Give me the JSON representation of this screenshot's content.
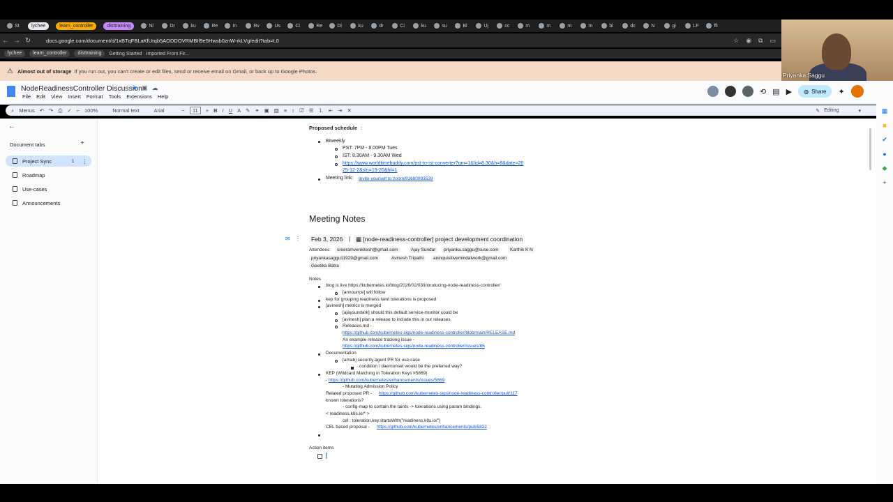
{
  "browser": {
    "tabs": [
      "St",
      "lychee",
      "learn_controller",
      "disttraining",
      "Nl",
      "Dr",
      "ku",
      "Re",
      "In",
      "Rv",
      "Us",
      "Ci",
      "Re",
      "Di",
      "ku",
      "dr",
      "Ci",
      "ku",
      "su",
      "Bl",
      "Uj",
      "cc",
      "m",
      "m",
      "m",
      "m",
      "bl",
      "dc",
      "N",
      "gi",
      "LF",
      "ffi"
    ],
    "url": "docs.google.com/document/d/1xBTqFBLaKfUrqb5AODDOVRMBIf9e5Hwsb0znW-rkLVg/edit?tab=t.0",
    "bookmarks": [
      "lychee",
      "learn_controller",
      "disttraining",
      "Getting Started",
      "Imported From Fir..."
    ]
  },
  "video": {
    "name": "Priyanka Saggu"
  },
  "banner": {
    "title": "Almost out of storage",
    "text": "If you run out, you can't create or edit files, send or receive email on Gmail, or back up to Google Photos."
  },
  "doc": {
    "title": "NodeReadinessController Discussion",
    "menu": [
      "File",
      "Edit",
      "View",
      "Insert",
      "Format",
      "Tools",
      "Extensions",
      "Help"
    ],
    "share_label": "Share"
  },
  "toolbar": {
    "menus": "Menus",
    "zoom": "100%",
    "style": "Normal text",
    "font": "Arial",
    "size": "11",
    "mode": "Editing"
  },
  "sidebar": {
    "label": "Document tabs",
    "items": [
      {
        "label": "Project Sync",
        "badge": "1"
      },
      {
        "label": "Roadmap"
      },
      {
        "label": "Use-cases"
      },
      {
        "label": "Announcements"
      }
    ]
  },
  "content": {
    "schedule_heading": "Proposed schedule",
    "biweekly": "Biweekly",
    "pst": "PST: 7PM - 8.00PM Tues",
    "ist": "IST:  8.30AM - 9.30AM Wed",
    "tz_link_1": "https://www.worldtimebuddy.com/pst-to-ist-converter?qm=1&lid=8,30&h=8&date=20",
    "tz_link_2": "25-12-2&sln=19-20&hf=1",
    "meeting_link_label": "Meeting link:",
    "meeting_link": "Invite yourself to zoom/91680993539",
    "meeting_notes_heading": "Meeting Notes",
    "date": "Feb 3, 2026",
    "event": "[node-readiness-controller]  project development coordination",
    "attendees_label": "Attendees:",
    "attendees": [
      "sreeramvenkitesh@gmail.com",
      "Ajay Sundar",
      "priyanka.saggu@suse.com",
      "Karthik K N",
      "priyankasaggu11929@gmail.com",
      "Avinesh Tripathi",
      "aninquisitivemindatwork@gmail.com",
      "Geetika Batra"
    ],
    "notes_label": "Notes",
    "lines": [
      "blog is live https://kubernetes.io/blog/2026/02/03/introducing-node-readiness-controller/",
      "[announce] will follow",
      "kep for grouping readiness taint tolerations is proposed",
      "[avinesh] metrics is merged",
      "[ajaysundark] should this default service-monitor could be",
      "[avinesh] plan a release to include this in our releases",
      "Releases.md -",
      "https://github.com/kubernetes-sigs/node-readiness-controller/blob/main/RELEASE.md",
      "An example release tracking issue -",
      "https://github.com/kubernetes-sigs/node-readiness-controller/issues/85",
      "Documentation",
      "[amab] security-agent PR for use-case",
      "condition / daemonset would be the preferred way?",
      "KEP (Wildcard Matching in Toleration Keys #5869)",
      "https://github.com/kubernetes/enhancements/issues/5869",
      "- Mutating Admission Policy",
      "Related proposed PR -",
      "https://github.com/kubernetes-sigs/node-readiness-controller/pull/117",
      "known tolerations?",
      "- config-map to contain the taints -> tolerations using param bindings.",
      "< readiness.k8s.io/* >",
      "cel : toleration.key.startsWith(\"readiness.k8s.io/\")",
      "CEL based proposal -",
      "https://github.com/kubernetes/enhancements/pull/5822"
    ],
    "action_items_label": "Action items"
  }
}
